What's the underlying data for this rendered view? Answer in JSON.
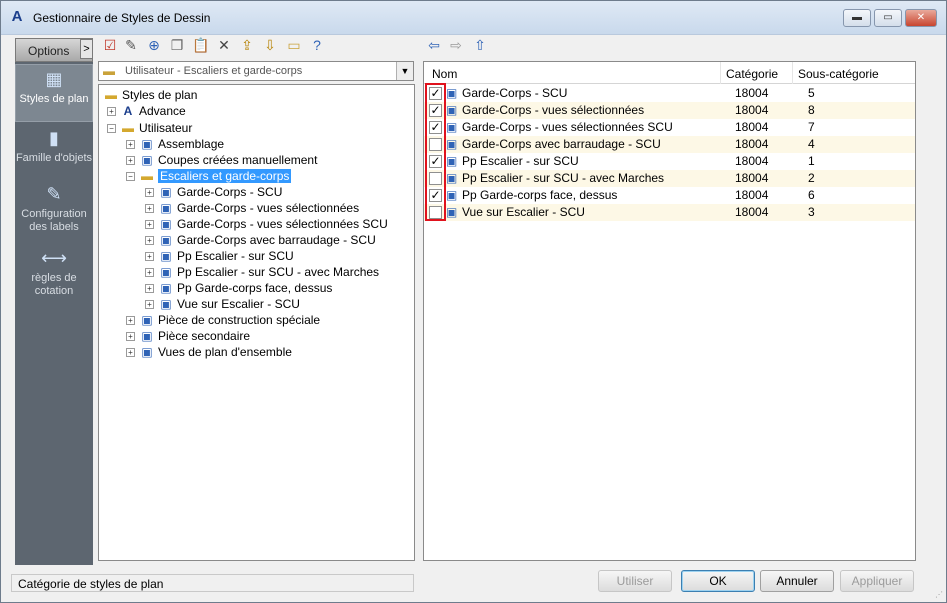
{
  "window": {
    "title": "Gestionnaire de Styles de Dessin",
    "controls": {
      "minimize": "▬",
      "maximize": "▭",
      "close": "✕"
    }
  },
  "nav": {
    "header": "Options",
    "toggle": ">",
    "items": [
      {
        "label": "Styles de plan",
        "icon": "plan-styles-icon",
        "active": true
      },
      {
        "label": "Famille d'objets",
        "icon": "object-family-icon",
        "active": false
      },
      {
        "label": "Configuration des labels",
        "icon": "label-config-icon",
        "active": false
      },
      {
        "label": "règles de cotation",
        "icon": "dimension-rules-icon",
        "active": false
      }
    ]
  },
  "toolbar": {
    "icons": [
      "new-style-icon",
      "edit-style-icon",
      "add-style-icon",
      "copy-icon",
      "paste-icon",
      "delete-icon",
      "export-icon",
      "import-icon",
      "preview-icon",
      "help-icon"
    ],
    "nav_icons": [
      "back-arrow-icon",
      "forward-arrow-icon",
      "up-arrow-icon"
    ]
  },
  "combo": {
    "value": "Utilisateur - Escaliers et garde-corps"
  },
  "tree": {
    "root": "Styles de plan",
    "nodes": [
      {
        "label": "Advance",
        "level": 1,
        "expander": "+",
        "icon": "advance"
      },
      {
        "label": "Utilisateur",
        "level": 1,
        "expander": "−",
        "icon": "folder"
      },
      {
        "label": "Assemblage",
        "level": 2,
        "expander": "+",
        "icon": "style"
      },
      {
        "label": "Coupes créées manuellement",
        "level": 2,
        "expander": "+",
        "icon": "style"
      },
      {
        "label": "Escaliers et garde-corps",
        "level": 2,
        "expander": "−",
        "icon": "folder",
        "selected": true
      },
      {
        "label": "Garde-Corps - SCU",
        "level": 3,
        "expander": "+",
        "icon": "style"
      },
      {
        "label": "Garde-Corps - vues sélectionnées",
        "level": 3,
        "expander": "+",
        "icon": "style"
      },
      {
        "label": "Garde-Corps - vues sélectionnées SCU",
        "level": 3,
        "expander": "+",
        "icon": "style"
      },
      {
        "label": "Garde-Corps avec barraudage - SCU",
        "level": 3,
        "expander": "+",
        "icon": "style"
      },
      {
        "label": "Pp Escalier - sur SCU",
        "level": 3,
        "expander": "+",
        "icon": "style"
      },
      {
        "label": "Pp Escalier - sur SCU - avec Marches",
        "level": 3,
        "expander": "+",
        "icon": "style"
      },
      {
        "label": "Pp Garde-corps face, dessus",
        "level": 3,
        "expander": "+",
        "icon": "style"
      },
      {
        "label": "Vue sur Escalier - SCU",
        "level": 3,
        "expander": "+",
        "icon": "style"
      },
      {
        "label": "Pièce de construction spéciale",
        "level": 2,
        "expander": "+",
        "icon": "style"
      },
      {
        "label": "Pièce secondaire",
        "level": 2,
        "expander": "+",
        "icon": "style"
      },
      {
        "label": "Vues de plan d'ensemble",
        "level": 2,
        "expander": "+",
        "icon": "style"
      }
    ]
  },
  "list": {
    "columns": [
      "Nom",
      "Catégorie",
      "Sous-catégorie"
    ],
    "rows": [
      {
        "checked": true,
        "name": "Garde-Corps - SCU",
        "category": "18004",
        "subcategory": "5"
      },
      {
        "checked": true,
        "name": "Garde-Corps - vues sélectionnées",
        "category": "18004",
        "subcategory": "8"
      },
      {
        "checked": true,
        "name": "Garde-Corps - vues sélectionnées SCU",
        "category": "18004",
        "subcategory": "7"
      },
      {
        "checked": false,
        "name": "Garde-Corps avec barraudage - SCU",
        "category": "18004",
        "subcategory": "4"
      },
      {
        "checked": true,
        "name": "Pp Escalier - sur SCU",
        "category": "18004",
        "subcategory": "1"
      },
      {
        "checked": false,
        "name": "Pp Escalier - sur SCU - avec Marches",
        "category": "18004",
        "subcategory": "2"
      },
      {
        "checked": true,
        "name": "Pp Garde-corps face, dessus",
        "category": "18004",
        "subcategory": "6"
      },
      {
        "checked": false,
        "name": "Vue sur Escalier - SCU",
        "category": "18004",
        "subcategory": "3"
      }
    ]
  },
  "status": {
    "text": "Catégorie de styles de plan"
  },
  "buttons": {
    "use": "Utiliser",
    "ok": "OK",
    "cancel": "Annuler",
    "apply": "Appliquer"
  },
  "colors": {
    "selection": "#3399ff",
    "highlight_box": "#e0121d",
    "nav_background": "#5d6670",
    "row_alt": "#fdf8e6"
  }
}
